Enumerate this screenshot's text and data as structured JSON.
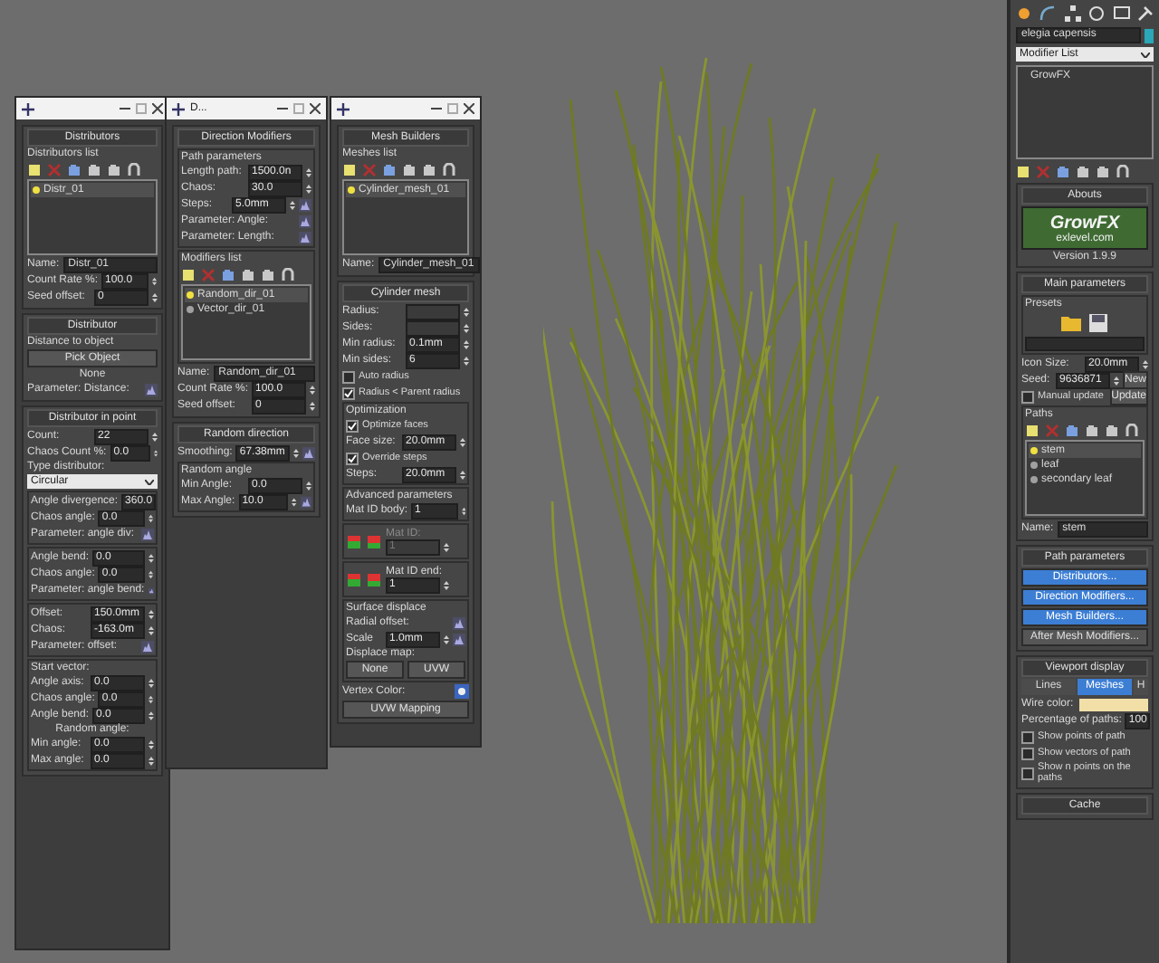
{
  "windows": [
    {
      "rollouts": [
        {
          "title": "Distributors",
          "rows": [
            {
              "kind": "label",
              "text": "Distributors list"
            },
            {
              "kind": "tools"
            },
            {
              "kind": "list",
              "items": [
                {
                  "label": "Distr_01",
                  "selected": true
                }
              ]
            },
            {
              "kind": "field",
              "label": "Name:",
              "value": "Distr_01"
            },
            {
              "kind": "spin",
              "label": "Count Rate %:",
              "value": "100.0"
            },
            {
              "kind": "spin",
              "label": "Seed offset:",
              "value": "0"
            }
          ]
        },
        {
          "title": "Distributor",
          "rows": [
            {
              "kind": "label",
              "text": "Distance to object"
            },
            {
              "kind": "button",
              "label": "Pick Object"
            },
            {
              "kind": "caption",
              "text": "None"
            },
            {
              "kind": "param",
              "label": "Parameter: Distance:"
            }
          ]
        },
        {
          "title": "Distributor in point",
          "rows": [
            {
              "kind": "spin",
              "label": "Count:",
              "value": "22"
            },
            {
              "kind": "spin",
              "label": "Chaos Count %:",
              "value": "0.0"
            },
            {
              "kind": "label",
              "text": "Type distributor:"
            },
            {
              "kind": "dropdown",
              "value": "Circular"
            },
            {
              "kind": "group",
              "rows": [
                {
                  "kind": "spin",
                  "label": "Angle divergence:",
                  "value": "360.0"
                },
                {
                  "kind": "spin",
                  "label": "Chaos angle:",
                  "value": "0.0"
                },
                {
                  "kind": "param",
                  "label": "Parameter: angle div:"
                }
              ]
            },
            {
              "kind": "group",
              "rows": [
                {
                  "kind": "spin",
                  "label": "Angle bend:",
                  "value": "0.0"
                },
                {
                  "kind": "spin",
                  "label": "Chaos angle:",
                  "value": "0.0"
                },
                {
                  "kind": "param",
                  "label": "Parameter: angle bend:"
                }
              ]
            },
            {
              "kind": "group",
              "rows": [
                {
                  "kind": "spin",
                  "label": "Offset:",
                  "value": "150.0mm"
                },
                {
                  "kind": "spin",
                  "label": "Chaos:",
                  "value": "-163.0m"
                },
                {
                  "kind": "param",
                  "label": "Parameter: offset:"
                }
              ]
            },
            {
              "kind": "group",
              "title": "Start vector:",
              "rows": [
                {
                  "kind": "spin",
                  "label": "Angle axis:",
                  "value": "0.0"
                },
                {
                  "kind": "spin",
                  "label": "Chaos angle:",
                  "value": "0.0"
                },
                {
                  "kind": "spin",
                  "label": "Angle bend:",
                  "value": "0.0"
                },
                {
                  "kind": "caption",
                  "text": "Random angle:"
                },
                {
                  "kind": "spin",
                  "label": "Min angle:",
                  "value": "0.0"
                },
                {
                  "kind": "spin",
                  "label": "Max angle:",
                  "value": "0.0"
                }
              ]
            }
          ]
        }
      ]
    },
    {
      "title": "D...",
      "rollouts": [
        {
          "title": "Direction Modifiers",
          "rows": [
            {
              "kind": "group",
              "title": "Path parameters",
              "rows": [
                {
                  "kind": "spin",
                  "label": "Length path:",
                  "value": "1500.0n"
                },
                {
                  "kind": "spin",
                  "label": "Chaos:",
                  "value": "30.0"
                },
                {
                  "kind": "spin",
                  "label": "Steps:",
                  "value": "5.0mm",
                  "graph": true
                },
                {
                  "kind": "param",
                  "label": "Parameter: Angle:"
                },
                {
                  "kind": "param",
                  "label": "Parameter: Length:"
                }
              ]
            },
            {
              "kind": "group",
              "title": "Modifiers list",
              "rows": [
                {
                  "kind": "tools"
                },
                {
                  "kind": "list",
                  "items": [
                    {
                      "label": "Random_dir_01",
                      "selected": true
                    },
                    {
                      "label": "Vector_dir_01",
                      "selected": false
                    }
                  ]
                }
              ]
            },
            {
              "kind": "field",
              "label": "Name:",
              "value": "Random_dir_01"
            },
            {
              "kind": "spin",
              "label": "Count Rate %:",
              "value": "100.0"
            },
            {
              "kind": "spin",
              "label": "Seed offset:",
              "value": "0"
            }
          ]
        },
        {
          "title": "Random direction",
          "rows": [
            {
              "kind": "spin",
              "label": "Smoothing:",
              "value": "67.38mm",
              "graph": true
            },
            {
              "kind": "group",
              "title": "Random angle",
              "rows": [
                {
                  "kind": "spin",
                  "label": "Min Angle:",
                  "value": "0.0"
                },
                {
                  "kind": "spin",
                  "label": "Max Angle:",
                  "value": "10.0",
                  "graph": true
                }
              ]
            }
          ]
        }
      ]
    },
    {
      "rollouts": [
        {
          "title": "Mesh Builders",
          "rows": [
            {
              "kind": "label",
              "text": "Meshes list"
            },
            {
              "kind": "tools"
            },
            {
              "kind": "list",
              "items": [
                {
                  "label": "Cylinder_mesh_01",
                  "selected": true
                }
              ]
            },
            {
              "kind": "field",
              "label": "Name:",
              "value": "Cylinder_mesh_01"
            }
          ]
        },
        {
          "title": "Cylinder mesh",
          "rows": [
            {
              "kind": "spin",
              "label": "Radius:",
              "disabled": true
            },
            {
              "kind": "spin",
              "label": "Sides:",
              "disabled": true
            },
            {
              "kind": "spin",
              "label": "Min radius:",
              "value": "0.1mm"
            },
            {
              "kind": "spin",
              "label": "Min sides:",
              "value": "6"
            },
            {
              "kind": "check",
              "label": "Auto radius",
              "checked": false
            },
            {
              "kind": "check",
              "label": "Radius < Parent radius",
              "checked": true
            },
            {
              "kind": "group",
              "title": "Optimization",
              "rows": [
                {
                  "kind": "check",
                  "label": "Optimize faces",
                  "checked": true
                },
                {
                  "kind": "spin",
                  "label": "Face size:",
                  "value": "20.0mm"
                },
                {
                  "kind": "check",
                  "label": "Override steps",
                  "checked": true
                },
                {
                  "kind": "spin",
                  "label": "Steps:",
                  "value": "20.0mm"
                }
              ]
            },
            {
              "kind": "group",
              "title": "Advanced parameters",
              "rows": [
                {
                  "kind": "spin",
                  "label": "Mat ID body:",
                  "value": "1"
                }
              ]
            },
            {
              "kind": "matid",
              "label": "Mat ID:",
              "value": "1",
              "disabled": true
            },
            {
              "kind": "matid",
              "label": "Mat ID end:",
              "value": "1",
              "disabled": false
            },
            {
              "kind": "group",
              "title": "Surface displace",
              "rows": [
                {
                  "kind": "param",
                  "label": "Radial offset:"
                },
                {
                  "kind": "spin",
                  "label": "Scale",
                  "value": "1.0mm",
                  "graph": true
                },
                {
                  "kind": "label",
                  "text": "Displace map:"
                },
                {
                  "kind": "buttons",
                  "items": [
                    "None",
                    "UVW"
                  ]
                }
              ]
            },
            {
              "kind": "vcolor",
              "label": "Vertex Color:"
            },
            {
              "kind": "button",
              "label": "UVW Mapping"
            }
          ]
        }
      ]
    }
  ],
  "command_panel": {
    "object_name": "elegia capensis",
    "modifier_list": "Modifier List",
    "stack": [
      "GrowFX"
    ],
    "rollouts": [
      {
        "title": "Abouts",
        "rows": [
          {
            "kind": "logo",
            "title": "GrowFX",
            "subtitle": "exlevel.com",
            "version": "Version 1.9.9"
          }
        ]
      },
      {
        "title": "Main parameters",
        "rows": [
          {
            "kind": "group",
            "title": "Presets",
            "rows": [
              {
                "kind": "presets"
              }
            ]
          },
          {
            "kind": "spin",
            "label": "Icon Size:",
            "value": "20.0mm"
          },
          {
            "kind": "spinbtn",
            "label": "Seed:",
            "value": "9636871",
            "button": "New"
          },
          {
            "kind": "checkbtn",
            "label": "Manual update",
            "checked": false,
            "button": "Update"
          },
          {
            "kind": "group",
            "title": "Paths",
            "rows": [
              {
                "kind": "tools"
              },
              {
                "kind": "list",
                "items": [
                  {
                    "label": "stem",
                    "selected": true
                  },
                  {
                    "label": "leaf",
                    "selected": false
                  },
                  {
                    "label": "secondary leaf",
                    "selected": false
                  }
                ]
              }
            ]
          },
          {
            "kind": "field",
            "label": "Name:",
            "value": "stem"
          }
        ]
      },
      {
        "title": "Path parameters",
        "rows": [
          {
            "kind": "button",
            "label": "Distributors...",
            "active": true
          },
          {
            "kind": "button",
            "label": "Direction Modifiers...",
            "active": true
          },
          {
            "kind": "button",
            "label": "Mesh Builders...",
            "active": true
          },
          {
            "kind": "button",
            "label": "After Mesh Modifiers...",
            "active": false
          }
        ]
      },
      {
        "title": "Viewport display",
        "rows": [
          {
            "kind": "tabs",
            "items": [
              {
                "label": "Lines",
                "selected": false
              },
              {
                "label": "Meshes",
                "selected": true
              },
              {
                "label": "H",
                "selected": false
              }
            ]
          },
          {
            "kind": "swatch",
            "label": "Wire color:"
          },
          {
            "kind": "spin",
            "label": "Percentage of paths:",
            "value": "100"
          },
          {
            "kind": "check",
            "label": "Show points of path",
            "checked": false
          },
          {
            "kind": "check",
            "label": "Show vectors of path",
            "checked": false
          },
          {
            "kind": "check",
            "label": "Show n points on the paths",
            "checked": false
          }
        ]
      },
      {
        "title": "Cache"
      }
    ]
  }
}
